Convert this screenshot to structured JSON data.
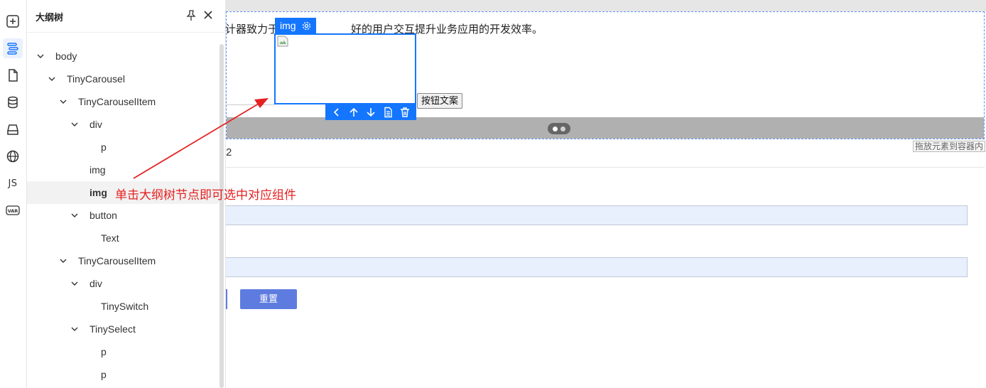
{
  "outline_panel": {
    "title": "大纲树",
    "tree": [
      {
        "label": "body",
        "expanded": true
      },
      {
        "label": "TinyCarousel",
        "expanded": true
      },
      {
        "label": "TinyCarouselItem",
        "expanded": true
      },
      {
        "label": "div",
        "expanded": true
      },
      {
        "label": "p"
      },
      {
        "label": "img"
      },
      {
        "label": "img",
        "selected": true
      },
      {
        "label": "button",
        "expanded": true
      },
      {
        "label": "Text"
      },
      {
        "label": "TinyCarouselItem",
        "expanded": true
      },
      {
        "label": "div",
        "expanded": true
      },
      {
        "label": "TinySwitch"
      },
      {
        "label": "TinySelect",
        "expanded": true
      },
      {
        "label": "p"
      },
      {
        "label": "p"
      }
    ]
  },
  "icon_bar": {
    "items": [
      "add-icon",
      "outline-icon",
      "page-icon",
      "database-icon",
      "block-icon",
      "globe-icon",
      "js-icon",
      "var-icon"
    ],
    "js_label": "JS",
    "var_label": "VAR",
    "active": "outline-icon"
  },
  "canvas": {
    "paragraph_visible_a": "计器致力于",
    "paragraph_visible_b": "好的用户交互提升业务应用的开发效率。",
    "button_text": "按钮文案",
    "drop_hint": "拖放元素到容器内",
    "number_label": "2",
    "reset_button": "重置"
  },
  "selection": {
    "component_tag": "img"
  },
  "annotation": {
    "text": "单击大纲树节点即可选中对应组件",
    "color": "#e62121"
  },
  "colors": {
    "accent": "#1476ff",
    "button": "#5e7ce0"
  }
}
